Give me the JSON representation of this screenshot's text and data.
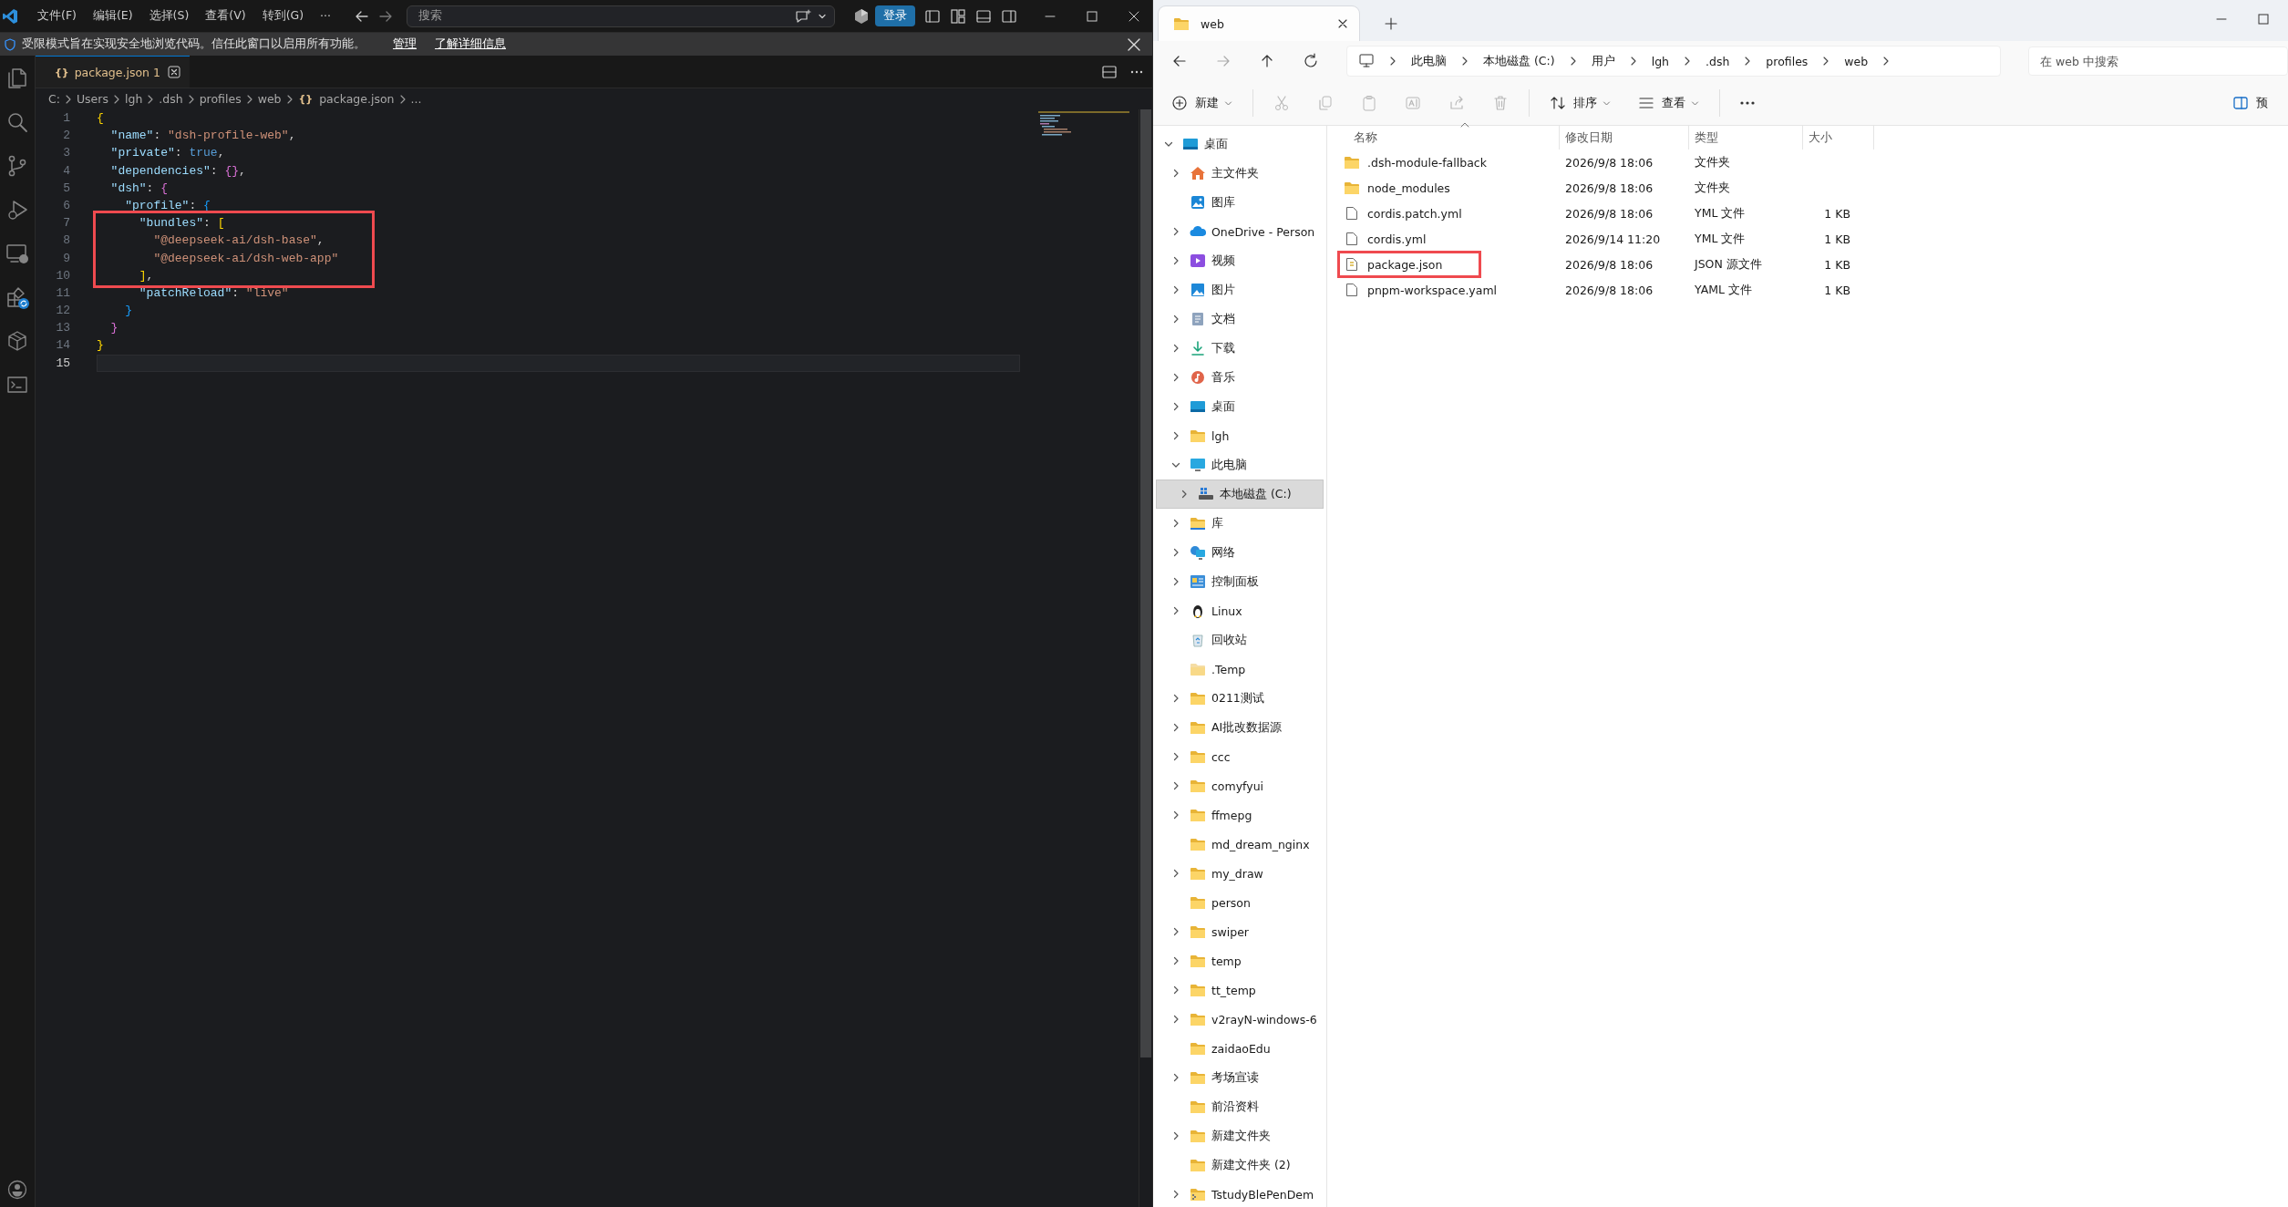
{
  "editor": {
    "menus": [
      "文件(F)",
      "编辑(E)",
      "选择(S)",
      "查看(V)",
      "转到(G)"
    ],
    "more": "···",
    "command_center": {
      "placeholder": "搜索"
    },
    "sign_in": "登录",
    "notice": {
      "text": "受限模式旨在实现安全地浏览代码。信任此窗口以启用所有功能。",
      "actions": [
        "管理",
        "了解详细信息"
      ]
    },
    "tabs": [
      {
        "icon": "{}",
        "label": "package.json",
        "problems": "1",
        "selected": true
      }
    ],
    "breadcrumb_icon": "{}",
    "breadcrumb": [
      "C:",
      "Users",
      "lgh",
      ".dsh",
      "profiles",
      "web",
      "package.json",
      "..."
    ],
    "lines": [
      {
        "number": "1",
        "current": false,
        "highlighted": false,
        "tokens": [
          {
            "kind": "bracket1",
            "text": "{"
          }
        ]
      },
      {
        "number": "2",
        "current": false,
        "highlighted": false,
        "tokens": [
          {
            "kind": "key",
            "text": "  \"name\""
          },
          {
            "kind": "punct",
            "text": ": "
          },
          {
            "kind": "string",
            "text": "\"dsh-profile-web\""
          },
          {
            "kind": "punct",
            "text": ","
          }
        ]
      },
      {
        "number": "3",
        "current": false,
        "highlighted": false,
        "tokens": [
          {
            "kind": "key",
            "text": "  \"private\""
          },
          {
            "kind": "punct",
            "text": ": "
          },
          {
            "kind": "literal",
            "text": "true"
          },
          {
            "kind": "punct",
            "text": ","
          }
        ]
      },
      {
        "number": "4",
        "current": false,
        "highlighted": false,
        "tokens": [
          {
            "kind": "key",
            "text": "  \"dependencies\""
          },
          {
            "kind": "punct",
            "text": ": "
          },
          {
            "kind": "bracket2",
            "text": "{}"
          },
          {
            "kind": "punct",
            "text": ","
          }
        ]
      },
      {
        "number": "5",
        "current": false,
        "highlighted": false,
        "tokens": [
          {
            "kind": "key",
            "text": "  \"dsh\""
          },
          {
            "kind": "punct",
            "text": ": "
          },
          {
            "kind": "bracket2",
            "text": "{"
          }
        ]
      },
      {
        "number": "6",
        "current": false,
        "highlighted": false,
        "tokens": [
          {
            "kind": "key",
            "text": "    \"profile\""
          },
          {
            "kind": "punct",
            "text": ": "
          },
          {
            "kind": "bracket3",
            "text": "{"
          }
        ]
      },
      {
        "number": "7",
        "current": false,
        "highlighted": true,
        "tokens": [
          {
            "kind": "key",
            "text": "      \"bundles\""
          },
          {
            "kind": "punct",
            "text": ": "
          },
          {
            "kind": "bracket1",
            "text": "["
          }
        ]
      },
      {
        "number": "8",
        "current": false,
        "highlighted": true,
        "tokens": [
          {
            "kind": "string",
            "text": "        \"@deepseek-ai/dsh-base\""
          },
          {
            "kind": "punct",
            "text": ","
          }
        ]
      },
      {
        "number": "9",
        "current": false,
        "highlighted": true,
        "tokens": [
          {
            "kind": "string",
            "text": "        \"@deepseek-ai/dsh-web-app\""
          }
        ]
      },
      {
        "number": "10",
        "current": false,
        "highlighted": true,
        "tokens": [
          {
            "kind": "bracket1",
            "text": "      ]"
          },
          {
            "kind": "punct",
            "text": ","
          }
        ]
      },
      {
        "number": "11",
        "current": false,
        "highlighted": false,
        "tokens": [
          {
            "kind": "key",
            "text": "      \"patchReload\""
          },
          {
            "kind": "punct",
            "text": ": "
          },
          {
            "kind": "string",
            "text": "\"live\""
          }
        ]
      },
      {
        "number": "12",
        "current": false,
        "highlighted": false,
        "tokens": [
          {
            "kind": "bracket3",
            "text": "    }"
          }
        ]
      },
      {
        "number": "13",
        "current": false,
        "highlighted": false,
        "tokens": [
          {
            "kind": "bracket2",
            "text": "  }"
          }
        ]
      },
      {
        "number": "14",
        "current": false,
        "highlighted": false,
        "tokens": [
          {
            "kind": "bracket1",
            "text": "}"
          }
        ]
      },
      {
        "number": "15",
        "current": true,
        "highlighted": false
      }
    ]
  },
  "explorer": {
    "tabs": [
      {
        "label": "web",
        "selected": true
      }
    ],
    "address": [
      "此电脑",
      "本地磁盘 (C:)",
      "用户",
      "lgh",
      ".dsh",
      "profiles",
      "web"
    ],
    "search": {
      "placeholder": "在 web 中搜索"
    },
    "toolbar": [
      {
        "kind": "new",
        "label": "新建",
        "disabled": false
      },
      {
        "kind": "cut",
        "disabled": true
      },
      {
        "kind": "copy",
        "disabled": true
      },
      {
        "kind": "paste",
        "disabled": true
      },
      {
        "kind": "rename",
        "disabled": true
      },
      {
        "kind": "share",
        "disabled": true
      },
      {
        "kind": "delete",
        "disabled": true
      },
      {
        "kind": "sort",
        "label": "排序",
        "disabled": false
      },
      {
        "kind": "view",
        "label": "查看",
        "disabled": false
      },
      {
        "kind": "more",
        "disabled": false
      },
      {
        "kind": "details",
        "label": "预",
        "disabled": false
      }
    ],
    "nav": [
      {
        "label": "桌面",
        "kind": "desktop",
        "expanded": true,
        "selected": false,
        "children": [
          {
            "label": "主文件夹",
            "kind": "home",
            "expanded": false,
            "selected": false
          },
          {
            "label": "图库",
            "kind": "gallery",
            "selected": false
          },
          {
            "label": "OneDrive - Person",
            "kind": "cloud",
            "expanded": false,
            "selected": false
          },
          {
            "label": "视频",
            "kind": "video",
            "expanded": false,
            "selected": false
          },
          {
            "label": "图片",
            "kind": "pictures",
            "expanded": false,
            "selected": false
          },
          {
            "label": "文档",
            "kind": "documents",
            "expanded": false,
            "selected": false
          },
          {
            "label": "下载",
            "kind": "downloads",
            "expanded": false,
            "selected": false
          },
          {
            "label": "音乐",
            "kind": "music",
            "expanded": false,
            "selected": false
          },
          {
            "label": "桌面",
            "kind": "desktop",
            "expanded": false,
            "selected": false
          },
          {
            "label": "lgh",
            "kind": "folder",
            "expanded": false,
            "selected": false
          },
          {
            "label": "此电脑",
            "kind": "pc",
            "expanded": true,
            "selected": false,
            "children": [
              {
                "label": "本地磁盘 (C:)",
                "kind": "drive",
                "expanded": false,
                "selected": true
              }
            ]
          },
          {
            "label": "库",
            "kind": "library",
            "expanded": false,
            "selected": false
          },
          {
            "label": "网络",
            "kind": "network",
            "expanded": false,
            "selected": false
          },
          {
            "label": "控制面板",
            "kind": "control",
            "expanded": false,
            "selected": false
          },
          {
            "label": "Linux",
            "kind": "linux",
            "expanded": false,
            "selected": false
          },
          {
            "label": "回收站",
            "kind": "recycle",
            "selected": false
          },
          {
            "label": ".Temp",
            "kind": "hidden",
            "selected": false
          },
          {
            "label": "0211测试",
            "kind": "folder",
            "expanded": false,
            "selected": false
          },
          {
            "label": "AI批改数据源",
            "kind": "folder",
            "expanded": false,
            "selected": false
          },
          {
            "label": "ccc",
            "kind": "folder",
            "expanded": false,
            "selected": false
          },
          {
            "label": "comyfyui",
            "kind": "folder",
            "expanded": false,
            "selected": false
          },
          {
            "label": "ffmepg",
            "kind": "folder",
            "expanded": false,
            "selected": false
          },
          {
            "label": "md_dream_nginx",
            "kind": "folder",
            "selected": false
          },
          {
            "label": "my_draw",
            "kind": "folder",
            "expanded": false,
            "selected": false
          },
          {
            "label": "person",
            "kind": "folder",
            "selected": false
          },
          {
            "label": "swiper",
            "kind": "folder",
            "expanded": false,
            "selected": false
          },
          {
            "label": "temp",
            "kind": "folder",
            "expanded": false,
            "selected": false
          },
          {
            "label": "tt_temp",
            "kind": "folder",
            "expanded": false,
            "selected": false
          },
          {
            "label": "v2rayN-windows-6",
            "kind": "folder",
            "expanded": false,
            "selected": false
          },
          {
            "label": "zaidaoEdu",
            "kind": "folder",
            "selected": false
          },
          {
            "label": "考场宣读",
            "kind": "folder",
            "expanded": false,
            "selected": false
          },
          {
            "label": "前沿资料",
            "kind": "folder",
            "selected": false
          },
          {
            "label": "新建文件夹",
            "kind": "folder",
            "expanded": false,
            "selected": false
          },
          {
            "label": "新建文件夹 (2)",
            "kind": "folder",
            "selected": false
          },
          {
            "label": "TstudyBlePenDem",
            "kind": "zip",
            "expanded": false,
            "selected": false
          }
        ]
      }
    ],
    "columns": [
      "名称",
      "修改日期",
      "类型",
      "大小"
    ],
    "files": [
      {
        "name": ".dsh-module-fallback",
        "kind": "folder",
        "date": "2026/9/8 18:06",
        "type": "文件夹",
        "highlighted": false
      },
      {
        "name": "node_modules",
        "kind": "folder",
        "date": "2026/9/8 18:06",
        "type": "文件夹",
        "highlighted": false
      },
      {
        "name": "cordis.patch.yml",
        "kind": "file",
        "date": "2026/9/8 18:06",
        "type": "YML 文件",
        "size": "1 KB",
        "highlighted": false
      },
      {
        "name": "cordis.yml",
        "kind": "file",
        "date": "2026/9/14 11:20",
        "type": "YML 文件",
        "size": "1 KB",
        "highlighted": false
      },
      {
        "name": "package.json",
        "kind": "json",
        "date": "2026/9/8 18:06",
        "type": "JSON 源文件",
        "size": "1 KB",
        "highlighted": true
      },
      {
        "name": "pnpm-workspace.yaml",
        "kind": "file",
        "date": "2026/9/8 18:06",
        "type": "YAML 文件",
        "size": "1 KB",
        "highlighted": false
      }
    ]
  }
}
